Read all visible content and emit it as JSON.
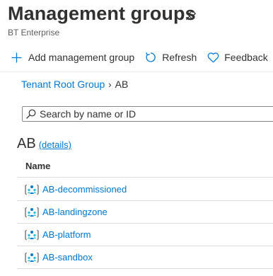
{
  "header": {
    "title": "Management groups",
    "subtitle": "BT Enterprise",
    "pin_icon": "pin-icon"
  },
  "toolbar": {
    "add_label": "Add management group",
    "refresh_label": "Refresh",
    "feedback_label": "Feedback"
  },
  "breadcrumb": {
    "root": "Tenant Root Group",
    "separator": "›",
    "current": "AB"
  },
  "search": {
    "placeholder": "Search by name or ID",
    "value": ""
  },
  "group": {
    "name": "AB",
    "details_link": "(details)"
  },
  "table": {
    "column_name": "Name",
    "rows": [
      {
        "name": "AB-decommissioned",
        "icon": "management-group-icon"
      },
      {
        "name": "AB-landingzone",
        "icon": "management-group-icon"
      },
      {
        "name": "AB-platform",
        "icon": "management-group-icon"
      },
      {
        "name": "AB-sandbox",
        "icon": "management-group-icon"
      }
    ]
  },
  "colors": {
    "accent": "#0078d4",
    "text": "#323130",
    "border": "#8a8886"
  }
}
